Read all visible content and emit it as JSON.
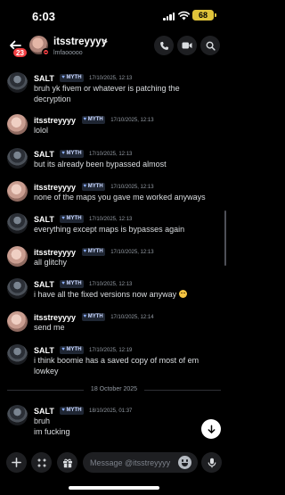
{
  "status_bar": {
    "time": "6:03",
    "battery": "68"
  },
  "header": {
    "unread_badge": "23",
    "name": "itsstreyyyy",
    "chevron": ">",
    "subtitle": "lmfaooooo"
  },
  "messages": [
    {
      "author": "SALT",
      "tag": "MYTH",
      "timestamp": "17/10/2025, 12:13",
      "lines": [
        "bruh yk fivem or whatever is patching the",
        "decryption"
      ]
    },
    {
      "author": "itsstreyyyy",
      "tag": "MYTH",
      "timestamp": "17/10/2025, 12:13",
      "lines": [
        "lolol"
      ]
    },
    {
      "author": "SALT",
      "tag": "MYTH",
      "timestamp": "17/10/2025, 12:13",
      "lines": [
        "but its already been bypassed almost"
      ]
    },
    {
      "author": "itsstreyyyy",
      "tag": "MYTH",
      "timestamp": "17/10/2025, 12:13",
      "lines": [
        "none of the maps you gave me worked anyways"
      ]
    },
    {
      "author": "SALT",
      "tag": "MYTH",
      "timestamp": "17/10/2025, 12:13",
      "lines": [
        "everything except maps is bypasses again"
      ]
    },
    {
      "author": "itsstreyyyy",
      "tag": "MYTH",
      "timestamp": "17/10/2025, 12:13",
      "lines": [
        "all glitchy"
      ]
    },
    {
      "author": "SALT",
      "tag": "MYTH",
      "timestamp": "17/10/2025, 12:13",
      "lines": [
        "i have all the fixed versions now anyway"
      ],
      "emoji": "grinning-sweat-emoji"
    },
    {
      "author": "itsstreyyyy",
      "tag": "MYTH",
      "timestamp": "17/10/2025, 12:14",
      "lines": [
        "send me"
      ]
    },
    {
      "author": "SALT",
      "tag": "MYTH",
      "timestamp": "17/10/2025, 12:19",
      "lines": [
        "i think boomie has a saved copy of most of em",
        "lowkey"
      ]
    },
    {
      "author": "SALT",
      "tag": "MYTH",
      "timestamp": "18/10/2025, 01:37",
      "lines": [
        "bruh",
        "im fucking"
      ]
    }
  ],
  "date_divider": "18 October 2025",
  "composer": {
    "placeholder": "Message @itsstreyyyy"
  },
  "icons": {
    "back": "arrow-left-icon",
    "call": "phone-icon",
    "video": "video-icon",
    "search": "search-icon",
    "add": "plus-icon",
    "apps": "apps-icon",
    "gift": "gift-icon",
    "emoji": "emoji-icon",
    "mic": "microphone-icon",
    "jump": "arrow-down-icon",
    "tag": "heart-icon"
  },
  "colors": {
    "background": "#000000",
    "dnd_status": "#f23f43",
    "battery": "#e0c43a",
    "tag_bg": "#1f2633"
  }
}
